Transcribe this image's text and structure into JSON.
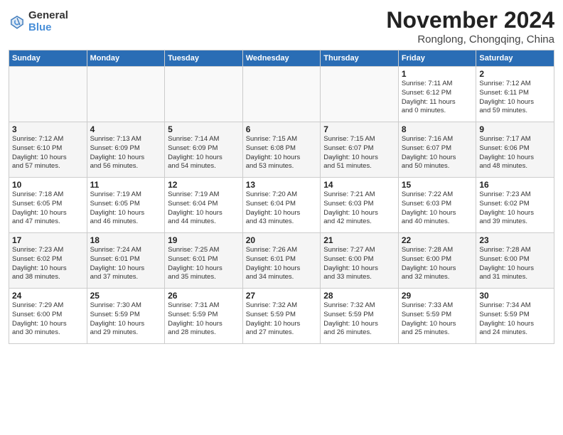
{
  "logo": {
    "general": "General",
    "blue": "Blue"
  },
  "title": "November 2024",
  "location": "Ronglong, Chongqing, China",
  "days_of_week": [
    "Sunday",
    "Monday",
    "Tuesday",
    "Wednesday",
    "Thursday",
    "Friday",
    "Saturday"
  ],
  "weeks": [
    [
      {
        "day": "",
        "info": ""
      },
      {
        "day": "",
        "info": ""
      },
      {
        "day": "",
        "info": ""
      },
      {
        "day": "",
        "info": ""
      },
      {
        "day": "",
        "info": ""
      },
      {
        "day": "1",
        "info": "Sunrise: 7:11 AM\nSunset: 6:12 PM\nDaylight: 11 hours\nand 0 minutes."
      },
      {
        "day": "2",
        "info": "Sunrise: 7:12 AM\nSunset: 6:11 PM\nDaylight: 10 hours\nand 59 minutes."
      }
    ],
    [
      {
        "day": "3",
        "info": "Sunrise: 7:12 AM\nSunset: 6:10 PM\nDaylight: 10 hours\nand 57 minutes."
      },
      {
        "day": "4",
        "info": "Sunrise: 7:13 AM\nSunset: 6:09 PM\nDaylight: 10 hours\nand 56 minutes."
      },
      {
        "day": "5",
        "info": "Sunrise: 7:14 AM\nSunset: 6:09 PM\nDaylight: 10 hours\nand 54 minutes."
      },
      {
        "day": "6",
        "info": "Sunrise: 7:15 AM\nSunset: 6:08 PM\nDaylight: 10 hours\nand 53 minutes."
      },
      {
        "day": "7",
        "info": "Sunrise: 7:15 AM\nSunset: 6:07 PM\nDaylight: 10 hours\nand 51 minutes."
      },
      {
        "day": "8",
        "info": "Sunrise: 7:16 AM\nSunset: 6:07 PM\nDaylight: 10 hours\nand 50 minutes."
      },
      {
        "day": "9",
        "info": "Sunrise: 7:17 AM\nSunset: 6:06 PM\nDaylight: 10 hours\nand 48 minutes."
      }
    ],
    [
      {
        "day": "10",
        "info": "Sunrise: 7:18 AM\nSunset: 6:05 PM\nDaylight: 10 hours\nand 47 minutes."
      },
      {
        "day": "11",
        "info": "Sunrise: 7:19 AM\nSunset: 6:05 PM\nDaylight: 10 hours\nand 46 minutes."
      },
      {
        "day": "12",
        "info": "Sunrise: 7:19 AM\nSunset: 6:04 PM\nDaylight: 10 hours\nand 44 minutes."
      },
      {
        "day": "13",
        "info": "Sunrise: 7:20 AM\nSunset: 6:04 PM\nDaylight: 10 hours\nand 43 minutes."
      },
      {
        "day": "14",
        "info": "Sunrise: 7:21 AM\nSunset: 6:03 PM\nDaylight: 10 hours\nand 42 minutes."
      },
      {
        "day": "15",
        "info": "Sunrise: 7:22 AM\nSunset: 6:03 PM\nDaylight: 10 hours\nand 40 minutes."
      },
      {
        "day": "16",
        "info": "Sunrise: 7:23 AM\nSunset: 6:02 PM\nDaylight: 10 hours\nand 39 minutes."
      }
    ],
    [
      {
        "day": "17",
        "info": "Sunrise: 7:23 AM\nSunset: 6:02 PM\nDaylight: 10 hours\nand 38 minutes."
      },
      {
        "day": "18",
        "info": "Sunrise: 7:24 AM\nSunset: 6:01 PM\nDaylight: 10 hours\nand 37 minutes."
      },
      {
        "day": "19",
        "info": "Sunrise: 7:25 AM\nSunset: 6:01 PM\nDaylight: 10 hours\nand 35 minutes."
      },
      {
        "day": "20",
        "info": "Sunrise: 7:26 AM\nSunset: 6:01 PM\nDaylight: 10 hours\nand 34 minutes."
      },
      {
        "day": "21",
        "info": "Sunrise: 7:27 AM\nSunset: 6:00 PM\nDaylight: 10 hours\nand 33 minutes."
      },
      {
        "day": "22",
        "info": "Sunrise: 7:28 AM\nSunset: 6:00 PM\nDaylight: 10 hours\nand 32 minutes."
      },
      {
        "day": "23",
        "info": "Sunrise: 7:28 AM\nSunset: 6:00 PM\nDaylight: 10 hours\nand 31 minutes."
      }
    ],
    [
      {
        "day": "24",
        "info": "Sunrise: 7:29 AM\nSunset: 6:00 PM\nDaylight: 10 hours\nand 30 minutes."
      },
      {
        "day": "25",
        "info": "Sunrise: 7:30 AM\nSunset: 5:59 PM\nDaylight: 10 hours\nand 29 minutes."
      },
      {
        "day": "26",
        "info": "Sunrise: 7:31 AM\nSunset: 5:59 PM\nDaylight: 10 hours\nand 28 minutes."
      },
      {
        "day": "27",
        "info": "Sunrise: 7:32 AM\nSunset: 5:59 PM\nDaylight: 10 hours\nand 27 minutes."
      },
      {
        "day": "28",
        "info": "Sunrise: 7:32 AM\nSunset: 5:59 PM\nDaylight: 10 hours\nand 26 minutes."
      },
      {
        "day": "29",
        "info": "Sunrise: 7:33 AM\nSunset: 5:59 PM\nDaylight: 10 hours\nand 25 minutes."
      },
      {
        "day": "30",
        "info": "Sunrise: 7:34 AM\nSunset: 5:59 PM\nDaylight: 10 hours\nand 24 minutes."
      }
    ]
  ]
}
